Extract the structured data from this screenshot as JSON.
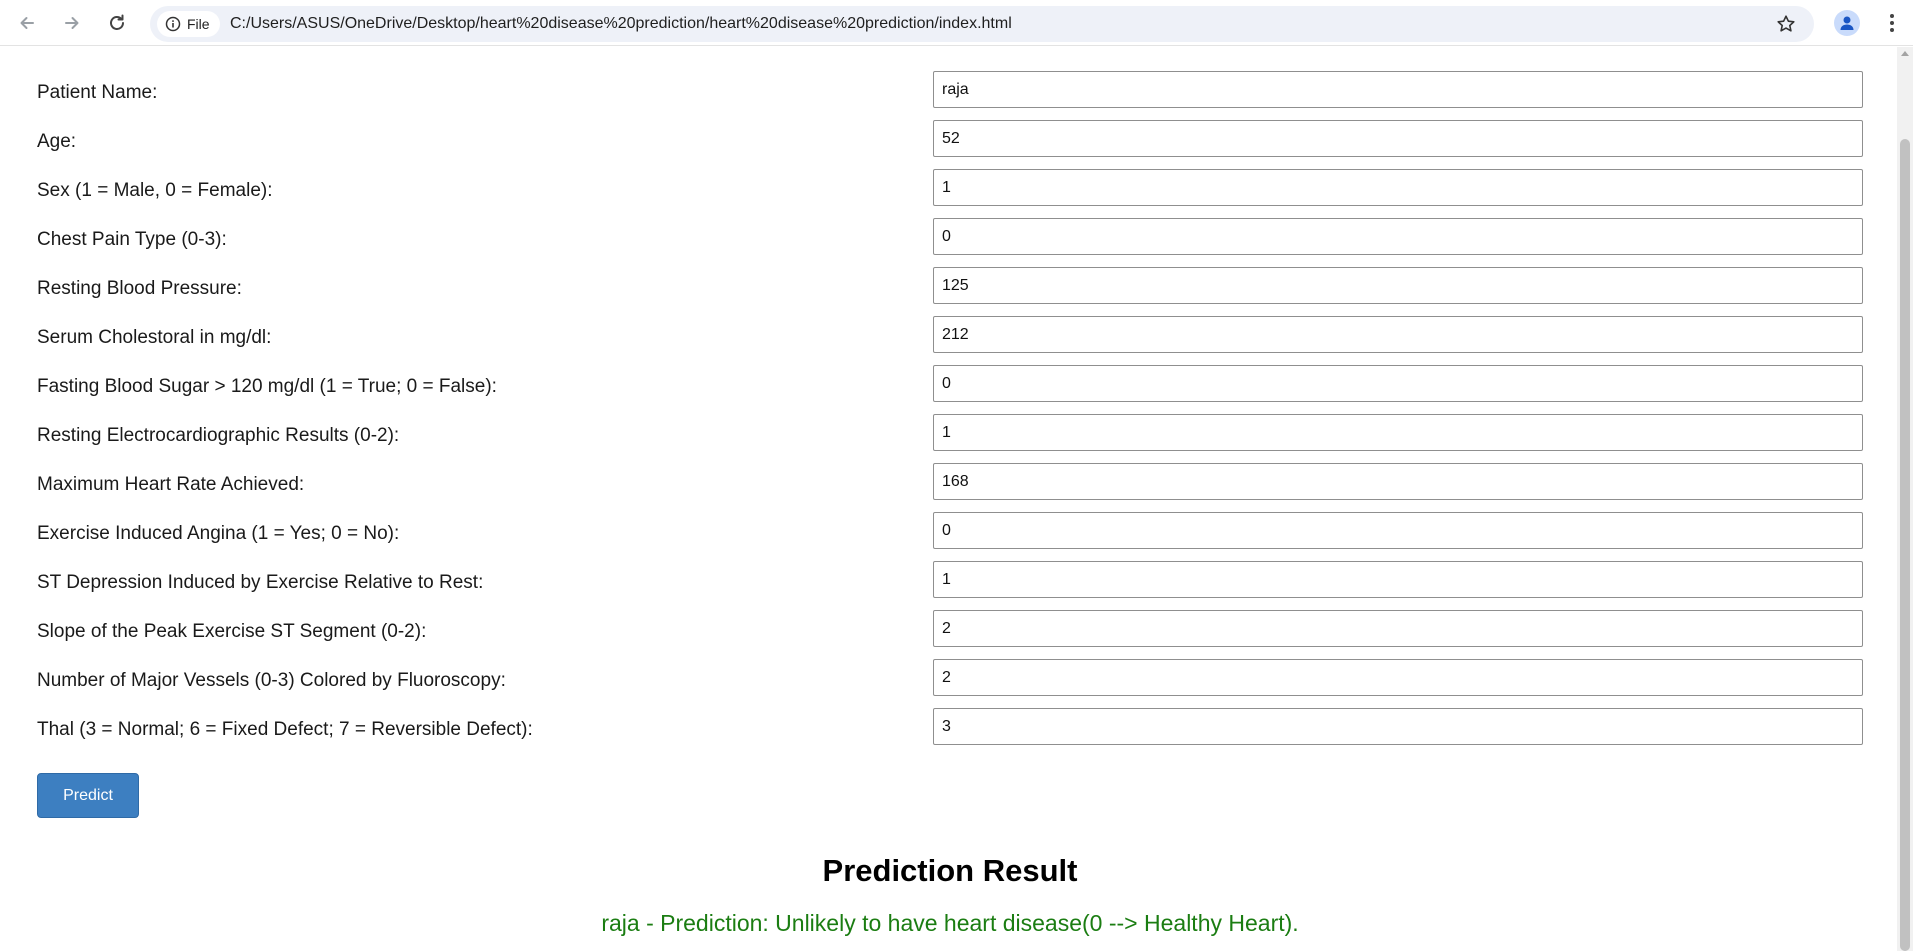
{
  "browser": {
    "file_chip_label": "File",
    "url": "C:/Users/ASUS/OneDrive/Desktop/heart%20disease%20prediction/heart%20disease%20prediction/index.html",
    "icons": {
      "back": "arrow-left-icon",
      "forward": "arrow-right-icon",
      "reload": "reload-icon",
      "info": "info-icon",
      "bookmark": "star-icon",
      "profile": "person-icon",
      "menu": "more-vertical-icon"
    }
  },
  "form": {
    "fields": [
      {
        "label": "Patient Name:",
        "value": "raja"
      },
      {
        "label": "Age:",
        "value": "52"
      },
      {
        "label": "Sex (1 = Male, 0 = Female):",
        "value": "1"
      },
      {
        "label": "Chest Pain Type (0-3):",
        "value": "0"
      },
      {
        "label": "Resting Blood Pressure:",
        "value": "125"
      },
      {
        "label": "Serum Cholestoral in mg/dl:",
        "value": "212"
      },
      {
        "label": "Fasting Blood Sugar > 120 mg/dl (1 = True; 0 = False):",
        "value": "0"
      },
      {
        "label": "Resting Electrocardiographic Results (0-2):",
        "value": "1"
      },
      {
        "label": "Maximum Heart Rate Achieved:",
        "value": "168"
      },
      {
        "label": "Exercise Induced Angina (1 = Yes; 0 = No):",
        "value": "0"
      },
      {
        "label": "ST Depression Induced by Exercise Relative to Rest:",
        "value": "1"
      },
      {
        "label": "Slope of the Peak Exercise ST Segment (0-2):",
        "value": "2"
      },
      {
        "label": "Number of Major Vessels (0-3) Colored by Fluoroscopy:",
        "value": "2"
      },
      {
        "label": "Thal (3 = Normal; 6 = Fixed Defect; 7 = Reversible Defect):",
        "value": "3"
      }
    ],
    "predict_label": "Predict"
  },
  "result": {
    "title": "Prediction Result",
    "text": "raja - Prediction: Unlikely to have heart disease(0 --> Healthy Heart).",
    "color": "#1b7d12"
  },
  "colors": {
    "button_bg": "#3d7fc1",
    "omnibox_bg": "#eef1f8"
  }
}
